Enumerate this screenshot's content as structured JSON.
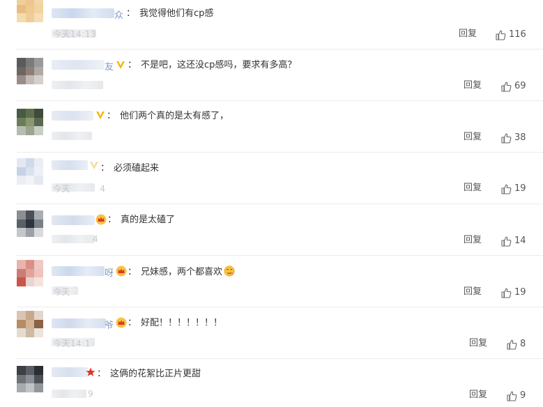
{
  "comments": [
    {
      "name_visible": "众",
      "badge": "none",
      "text": "我觉得他们有cp感",
      "time_visible": "今天14:13",
      "reply_label": "回复",
      "likes": "116"
    },
    {
      "name_visible": "友",
      "badge": "vip-v",
      "text": "不是吧，这还没cp感吗，要求有多高？",
      "time_visible": "",
      "reply_label": "回复",
      "likes": "69"
    },
    {
      "name_visible": "",
      "badge": "vip-v",
      "text": "他们两个真的是太有感了，",
      "time_visible": "",
      "reply_label": "回复",
      "likes": "38"
    },
    {
      "name_visible": "",
      "badge": "vip-v-faded",
      "text": "必须磕起来",
      "time_visible": "今天 4",
      "reply_label": "回复",
      "likes": "19"
    },
    {
      "name_visible": "",
      "badge": "crown",
      "text": "真的是太磕了",
      "time_visible": "4",
      "reply_label": "回复",
      "likes": "14"
    },
    {
      "name_visible": "呀",
      "badge": "crown",
      "text": "兄妹感，两个都喜欢",
      "emoji": "smirk-emoji",
      "time_visible": "今天",
      "reply_label": "回复",
      "likes": "19"
    },
    {
      "name_visible": "爷",
      "badge": "crown",
      "text": "好配！！！！！！！",
      "time_visible": "今天14:1",
      "reply_label": "回复",
      "likes": "8"
    },
    {
      "name_visible": "",
      "badge": "star",
      "text": "这俩的花絮比正片更甜",
      "time_visible": "9",
      "reply_label": "回复",
      "likes": "9"
    }
  ],
  "colors": {
    "text": "#333333",
    "action": "#555555",
    "name_blue": "#7e98c4",
    "vip_gold": "#f5b800",
    "crown_red": "#e0342b",
    "separator": "#ececec"
  }
}
